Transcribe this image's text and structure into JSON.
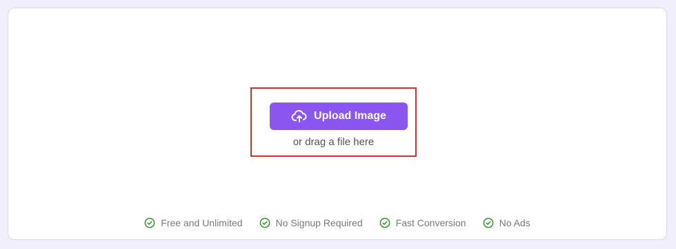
{
  "upload": {
    "button_label": "Upload Image",
    "button_icon": "cloud-upload-icon",
    "drag_hint": "or drag a file here"
  },
  "features": [
    {
      "label": "Free and Unlimited",
      "icon": "check-circle-icon"
    },
    {
      "label": "No Signup Required",
      "icon": "check-circle-icon"
    },
    {
      "label": "Fast Conversion",
      "icon": "check-circle-icon"
    },
    {
      "label": "No Ads",
      "icon": "check-circle-icon"
    }
  ],
  "colors": {
    "background": "#f2effc",
    "card": "#ffffff",
    "accent": "#8b55f0",
    "highlight_border": "#d32f2f",
    "check": "#3a9a2e",
    "feature_text": "#7a7a7a"
  }
}
